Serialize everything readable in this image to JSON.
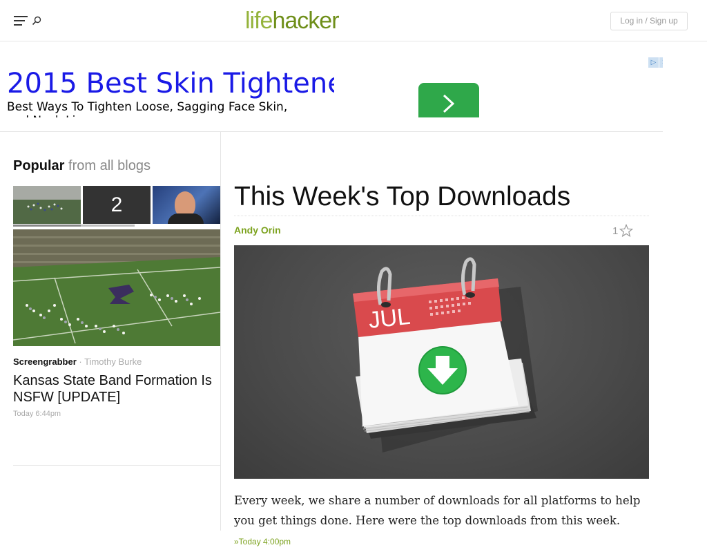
{
  "header": {
    "logo_part1": "life",
    "logo_part2": "hacker",
    "login_label": "Log in / Sign up",
    "menu_icon": "hamburger-icon",
    "search_icon": "search-icon"
  },
  "ad": {
    "title": "2015 Best Skin Tightene",
    "description": "Best Ways To Tighten Loose, Sagging Face Skin,",
    "description_cut": "and Neck Lines",
    "choices_label": "▷",
    "close_label": "✕",
    "button_color": "#2fa84a"
  },
  "popular": {
    "heading_bold": "Popular",
    "heading_rest": "from all blogs",
    "thumb2_label": "2",
    "category": "Screengrabber",
    "separator": " · ",
    "author": "Timothy Burke",
    "title": "Kansas State Band Formation Is NSFW [UPDATE]",
    "time": "Today 6:44pm"
  },
  "post": {
    "title": "This Week's Top Downloads",
    "author": "Andy Orin",
    "star_count": "1",
    "calendar_month": "JUL",
    "excerpt": "Every week, we share a number of downloads for all platforms to help you get things done. Here were the top downloads from this week.",
    "more_label": "»Today 4:00pm",
    "accent_color": "#7da320"
  }
}
